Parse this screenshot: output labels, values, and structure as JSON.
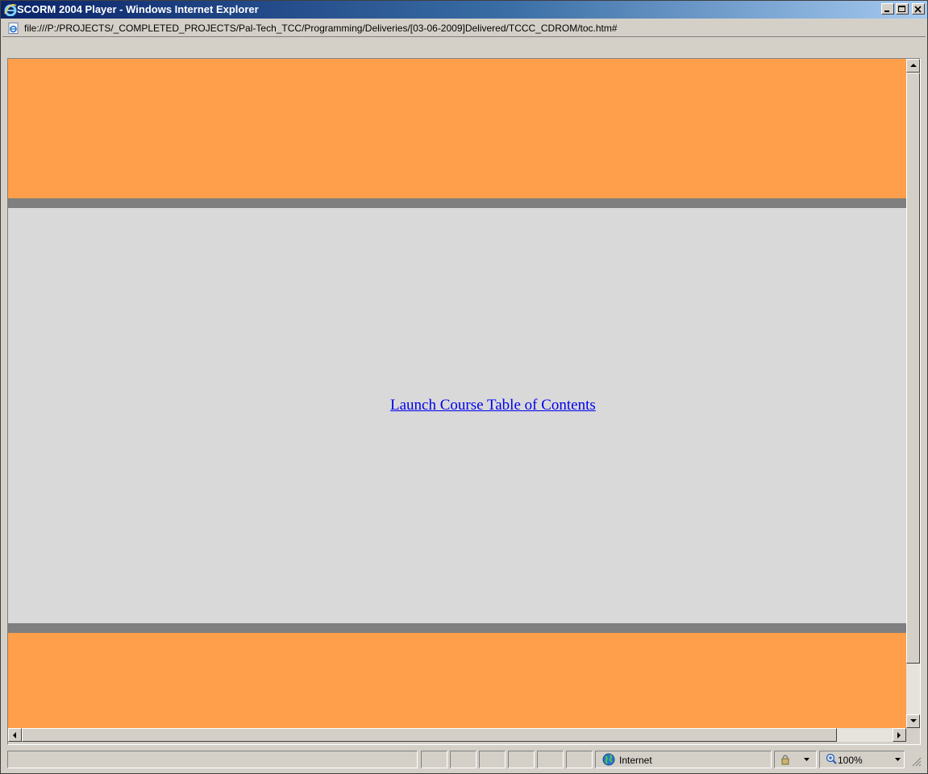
{
  "window": {
    "title": "SCORM 2004 Player - Windows Internet Explorer"
  },
  "address_bar": {
    "url": "file:///P:/PROJECTS/_COMPLETED_PROJECTS/Pal-Tech_TCC/Programming/Deliveries/[03-06-2009]Delivered/TCCC_CDROM/toc.htm#"
  },
  "content": {
    "link_text": "Launch Course Table of Contents"
  },
  "status_bar": {
    "zone": "Internet",
    "zoom": "100%"
  },
  "colors": {
    "band": "#ff9f4b",
    "separator": "#7f7f7f",
    "background": "#d9d9d9",
    "link": "#0000ee",
    "titlebar_start": "#0a246a"
  },
  "icons": [
    "ie-logo-icon",
    "page-icon",
    "minimize-icon",
    "maximize-icon",
    "close-icon",
    "globe-icon",
    "lock-icon",
    "zoom-icon",
    "scroll-up-icon",
    "scroll-down-icon",
    "scroll-left-icon",
    "scroll-right-icon",
    "resize-grip-icon"
  ]
}
